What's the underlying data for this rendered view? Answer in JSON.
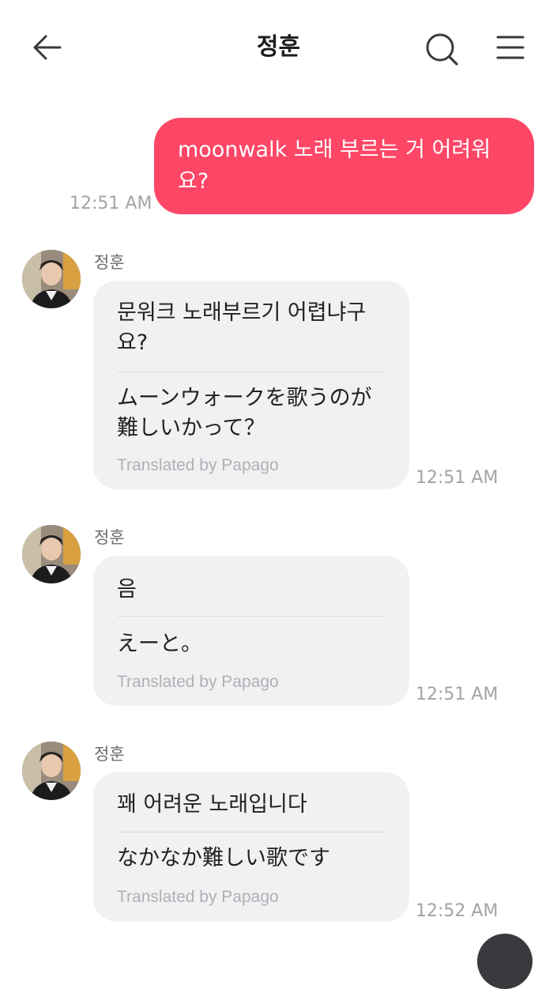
{
  "header": {
    "title": "정훈",
    "back_icon": "arrow-left-icon",
    "search_icon": "search-icon",
    "menu_icon": "hamburger-menu-icon"
  },
  "colors": {
    "outgoing_bubble": "#fe4667",
    "incoming_bubble": "#f1f1f3",
    "timestamp": "#a3a3a8"
  },
  "messages": [
    {
      "direction": "outgoing",
      "text": "moonwalk 노래 부르는 거 어려워요?",
      "time": "12:51 AM"
    },
    {
      "direction": "incoming",
      "sender": "정훈",
      "text": "문워크 노래부르기 어렵냐구요?",
      "translation": "ムーンウォークを歌うのが難しいかって？",
      "translated_by": "Translated by Papago",
      "time": "12:51 AM"
    },
    {
      "direction": "incoming",
      "sender": "정훈",
      "text": "음",
      "translation": "えーと。",
      "translated_by": "Translated by Papago",
      "time": "12:51 AM"
    },
    {
      "direction": "incoming",
      "sender": "정훈",
      "text": "꽤 어려운 노래입니다",
      "translation": "なかなか難しい歌です",
      "translated_by": "Translated by Papago",
      "time": "12:52 AM"
    }
  ]
}
